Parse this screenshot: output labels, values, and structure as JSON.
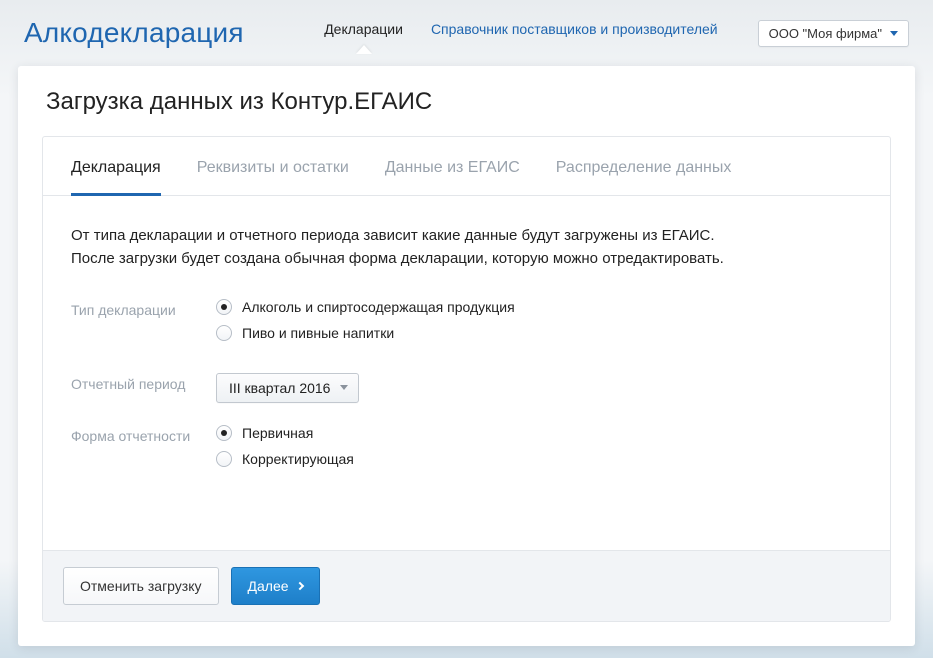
{
  "header": {
    "app_title": "Алкодекларация",
    "nav": [
      {
        "label": "Декларации",
        "active": true
      },
      {
        "label": "Справочник поставщиков и производителей",
        "active": false
      }
    ],
    "company": "ООО \"Моя фирма\""
  },
  "page": {
    "title": "Загрузка данных из Контур.ЕГАИС"
  },
  "wizard_tabs": [
    {
      "label": "Декларация",
      "active": true
    },
    {
      "label": "Реквизиты и остатки",
      "active": false
    },
    {
      "label": "Данные из ЕГАИС",
      "active": false
    },
    {
      "label": "Распределение данных",
      "active": false
    }
  ],
  "intro": {
    "line1": "От типа декларации и отчетного периода зависит какие данные будут загружены из ЕГАИС.",
    "line2": "После загрузки будет создана обычная форма декларации, которую можно отредактировать."
  },
  "form": {
    "decl_type": {
      "label": "Тип декларации",
      "options": [
        {
          "label": "Алкоголь и спиртосодержащая продукция",
          "selected": true
        },
        {
          "label": "Пиво и пивные напитки",
          "selected": false
        }
      ]
    },
    "period": {
      "label": "Отчетный период",
      "value": "III квартал 2016"
    },
    "form_kind": {
      "label": "Форма отчетности",
      "options": [
        {
          "label": "Первичная",
          "selected": true
        },
        {
          "label": "Корректирующая",
          "selected": false
        }
      ]
    }
  },
  "footer": {
    "cancel": "Отменить загрузку",
    "next": "Далее"
  }
}
